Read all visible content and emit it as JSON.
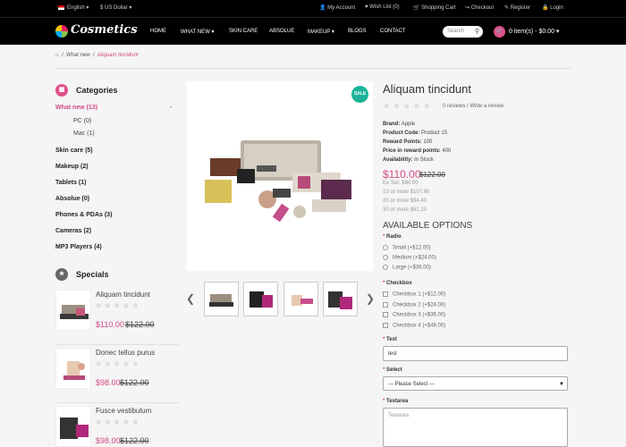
{
  "topbar": {
    "language": "English",
    "currency": "$ US Dollar",
    "links": [
      "My Account",
      "Wish List (0)",
      "Shopping Cart",
      "Checkout",
      "Register",
      "Login"
    ]
  },
  "header": {
    "logo": "Cosmetics",
    "nav": [
      "HOME",
      "WHAT NEW",
      "SKIN CARE",
      "ABSOLUE",
      "MAKEUP",
      "BLOGS",
      "CONTACT"
    ],
    "search_placeholder": "Search",
    "cart": "0 item(s) - $0.00"
  },
  "breadcrumb": {
    "items": [
      "What new",
      "Aliquam tincidunt"
    ]
  },
  "sidebar": {
    "categories_title": "Categories",
    "categories": [
      {
        "label": "What new (13)",
        "active": true,
        "toggle": "-"
      },
      {
        "label": "PC (0)",
        "sub": true
      },
      {
        "label": "Mac (1)",
        "sub": true
      },
      {
        "label": "Skin care (5)"
      },
      {
        "label": "Makeup (2)"
      },
      {
        "label": "Tablets (1)"
      },
      {
        "label": "Absolue (0)"
      },
      {
        "label": "Phones & PDAs (3)"
      },
      {
        "label": "Cameras (2)"
      },
      {
        "label": "MP3 Players (4)"
      }
    ],
    "specials_title": "Specials",
    "specials": [
      {
        "name": "Aliquam tincidunt",
        "price": "$110.00",
        "old_price": "$122.00",
        "rating": 0
      },
      {
        "name": "Donec tellus purus",
        "price": "$98.00",
        "old_price": "$122.00",
        "rating": 0
      },
      {
        "name": "Fusce vestibulum",
        "price": "$98.00",
        "old_price": "$122.00",
        "rating": 0
      }
    ]
  },
  "product": {
    "badge": "SALE",
    "title": "Aliquam tincidunt",
    "reviews": "0 reviews / Write a review",
    "rating": 0,
    "info": [
      {
        "label": "Brand:",
        "value": "Apple"
      },
      {
        "label": "Product Code:",
        "value": "Product 15"
      },
      {
        "label": "Reward Points:",
        "value": "100"
      },
      {
        "label": "Price in reward points:",
        "value": "400"
      },
      {
        "label": "Availability:",
        "value": "In Stock"
      }
    ],
    "price": "$110.00",
    "old_price": "$122.00",
    "ex_tax": "Ex Tax: $90.00",
    "discounts": [
      "10 or more $107.60",
      "20 or more $94.40",
      "30 or more $81.20"
    ],
    "options_title": "AVAILABLE OPTIONS",
    "radio_label": "Radio",
    "radios": [
      "Small (+$12.00)",
      "Medium (+$24.00)",
      "Large (+$36.00)"
    ],
    "checkbox_label": "Checkbox",
    "checkboxes": [
      "Checkbox 1 (+$12.00)",
      "Checkbox 2 (+$24.00)",
      "Checkbox 3 (+$36.00)",
      "Checkbox 4 (+$48.00)"
    ],
    "text_label": "Text",
    "text_value": "test",
    "select_label": "Select",
    "select_value": "--- Please Select ---",
    "textarea_label": "Textarea",
    "textarea_placeholder": "Textarea"
  },
  "colors": {
    "accent": "#d04a86",
    "sale": "#1cb39a",
    "dark": "#000000"
  }
}
